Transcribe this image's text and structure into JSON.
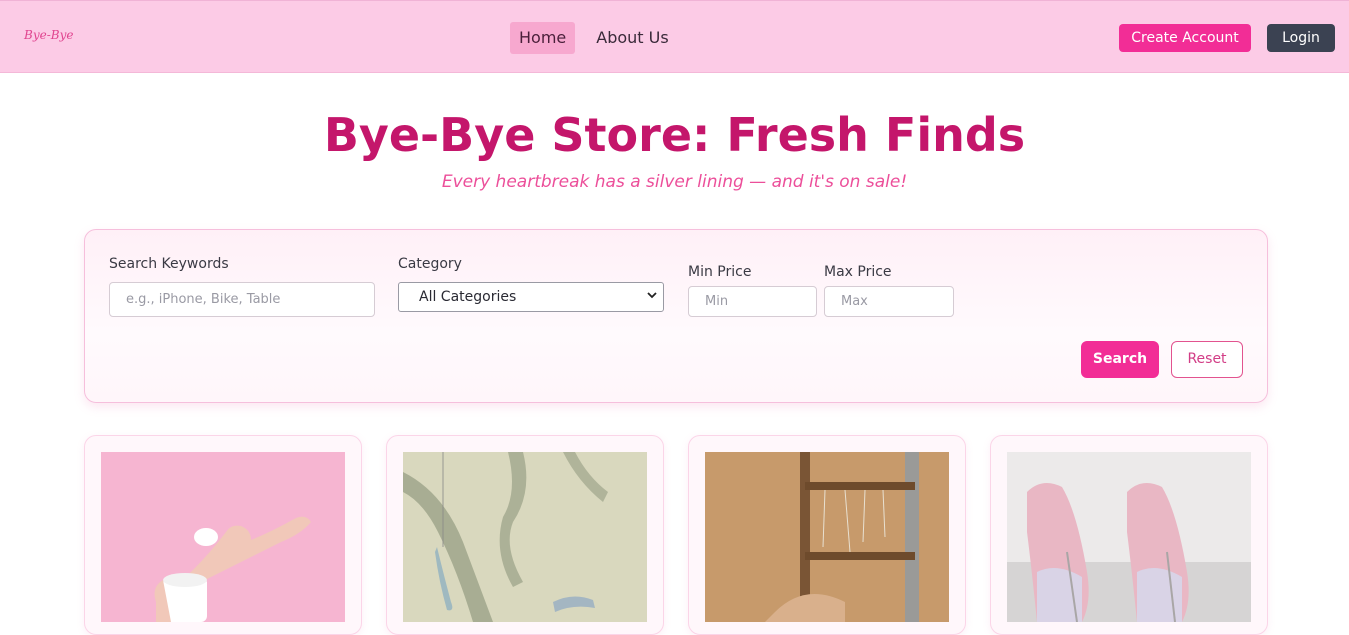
{
  "nav": {
    "logo": "Bye-Bye",
    "links": [
      {
        "label": "Home",
        "active": true
      },
      {
        "label": "About Us",
        "active": false
      }
    ],
    "create_account": "Create Account",
    "login": "Login"
  },
  "hero": {
    "title": "Bye-Bye Store: Fresh Finds",
    "subtitle": "Every heartbreak has a silver lining — and it's on sale!"
  },
  "search": {
    "keywords_label": "Search Keywords",
    "keywords_placeholder": "e.g., iPhone, Bike, Table",
    "category_label": "Category",
    "category_selected": "All Categories",
    "min_label": "Min Price",
    "min_placeholder": "Min",
    "max_label": "Max Price",
    "max_placeholder": "Max",
    "search_button": "Search",
    "reset_button": "Reset"
  },
  "products": [
    {
      "image": "hand-with-cream-jar-photo"
    },
    {
      "image": "hanging-glass-heels-photo"
    },
    {
      "image": "jewelry-ladder-and-heels-photo"
    },
    {
      "image": "glitter-pumps-photo"
    }
  ],
  "colors": {
    "brand_pink": "#f22d96",
    "nav_bg": "#fccbe6",
    "title": "#c4166b",
    "login_bg": "#3b4252"
  }
}
